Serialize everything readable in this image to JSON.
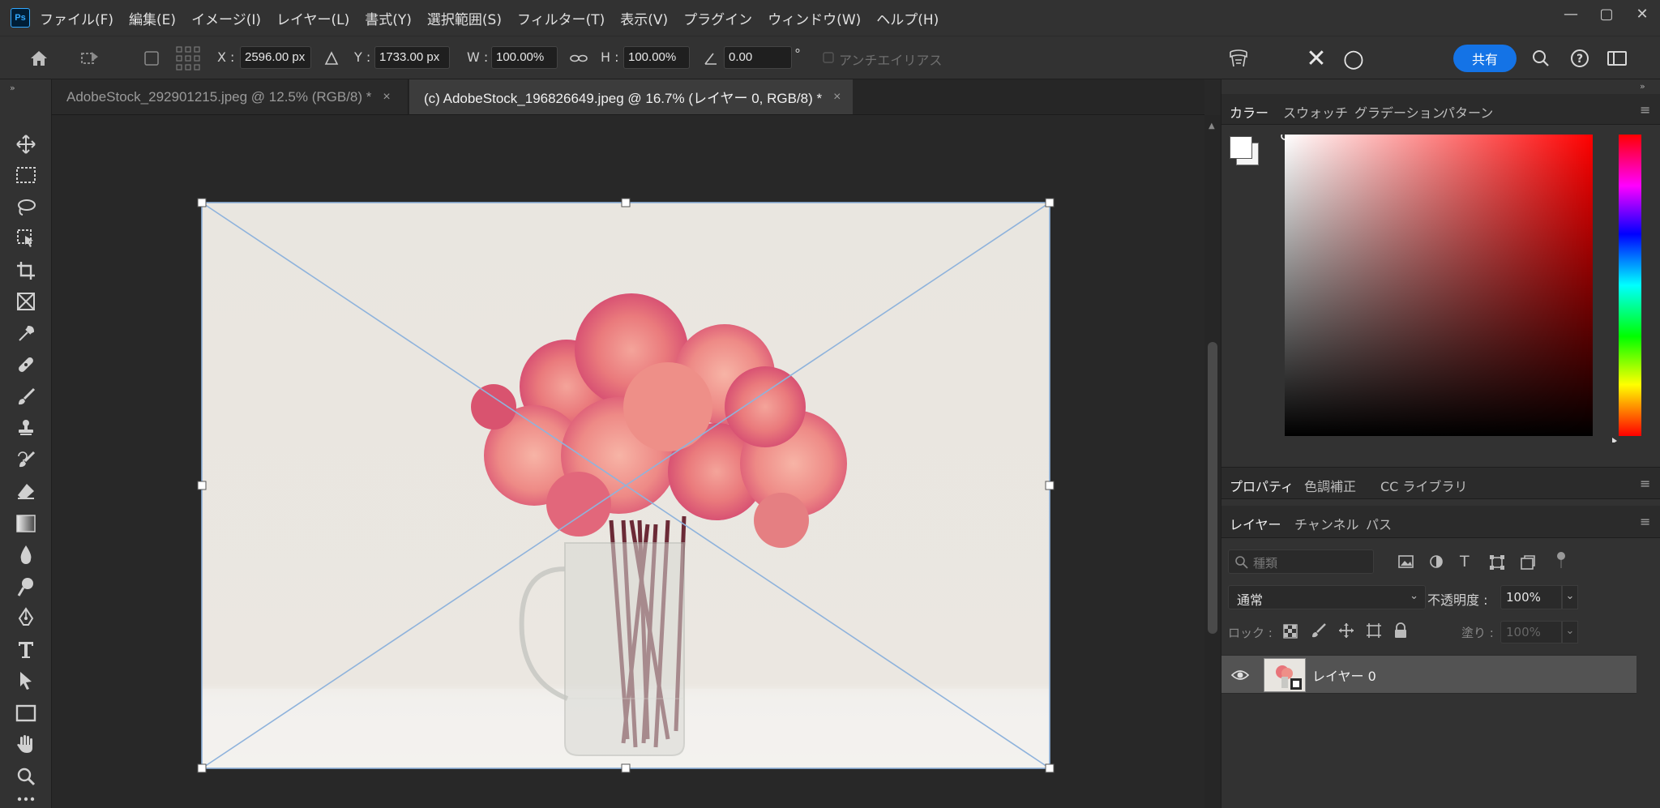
{
  "app": {
    "logo": "Ps"
  },
  "menu": [
    "ファイル(F)",
    "編集(E)",
    "イメージ(I)",
    "レイヤー(L)",
    "書式(Y)",
    "選択範囲(S)",
    "フィルター(T)",
    "表示(V)",
    "プラグイン",
    "ウィンドウ(W)",
    "ヘルプ(H)"
  ],
  "window_controls": {
    "minimize": "—",
    "maximize": "▢",
    "close": "✕"
  },
  "options": {
    "x_label": "X :",
    "x_value": "2596.00 px",
    "y_label": "Y :",
    "y_value": "1733.00 px",
    "w_label": "W :",
    "w_value": "100.00%",
    "h_label": "H :",
    "h_value": "100.00%",
    "angle_value": "0.00",
    "angle_unit": "°",
    "antialias_label": "アンチエイリアス",
    "cancel_glyph": "✕",
    "commit_glyph": "○",
    "share_label": "共有"
  },
  "tabs": [
    {
      "label": "AdobeStock_292901215.jpeg @ 12.5% (RGB/8) *",
      "close": "×",
      "active": false
    },
    {
      "label": "(c) AdobeStock_196826649.jpeg @ 16.7% (レイヤー 0, RGB/8) *",
      "close": "×",
      "active": true
    }
  ],
  "tools": [
    "move-tool-icon",
    "marquee-tool-icon",
    "lasso-tool-icon",
    "object-select-tool-icon",
    "crop-tool-icon",
    "frame-tool-icon",
    "eyedropper-tool-icon",
    "healing-brush-icon",
    "brush-tool-icon",
    "clone-stamp-icon",
    "history-brush-icon",
    "eraser-tool-icon",
    "gradient-tool-icon",
    "blur-tool-icon",
    "dodge-tool-icon",
    "pen-tool-icon",
    "type-tool-icon",
    "path-select-tool-icon",
    "rectangle-tool-icon",
    "hand-tool-icon",
    "zoom-tool-icon",
    "more-tools-icon"
  ],
  "color_panel": {
    "tabs": [
      "カラー",
      "スウォッチ",
      "グラデーション",
      "パターン"
    ],
    "hue_color": "#ff0000"
  },
  "props_panel": {
    "tabs": [
      "プロパティ",
      "色調補正",
      "CC ライブラリ"
    ]
  },
  "layers_panel": {
    "tabs": [
      "レイヤー",
      "チャンネル",
      "パス"
    ],
    "filter_placeholder": "種類",
    "blend_mode": "通常",
    "opacity_label": "不透明度 :",
    "opacity_value": "100%",
    "lock_label": "ロック :",
    "fill_label": "塗り :",
    "fill_value": "100%",
    "layers": [
      {
        "name": "レイヤー 0",
        "visible": true
      }
    ]
  },
  "colors": {
    "accent": "#1473e6",
    "bounding_box": "#8fb3dc"
  }
}
